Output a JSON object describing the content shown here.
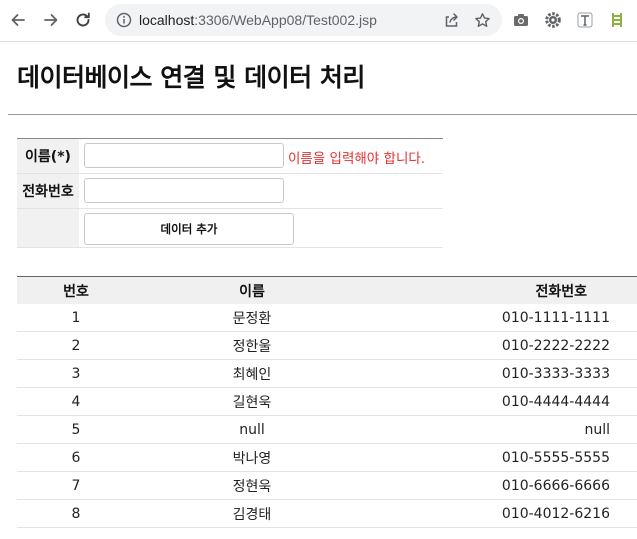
{
  "browser": {
    "url_host": "localhost",
    "url_rest": ":3306/WebApp08/Test002.jsp"
  },
  "page": {
    "title": "데이터베이스 연결 및 데이터 처리"
  },
  "form": {
    "name_label": "이름(*)",
    "name_value": "",
    "name_error": "이름을 입력해야 합니다.",
    "phone_label": "전화번호",
    "phone_value": "",
    "submit_label": "데이터 추가"
  },
  "table": {
    "headers": [
      "번호",
      "이름",
      "전화번호"
    ],
    "rows": [
      {
        "num": "1",
        "name": "문정환",
        "phone": "010-1111-1111"
      },
      {
        "num": "2",
        "name": "정한울",
        "phone": "010-2222-2222"
      },
      {
        "num": "3",
        "name": "최혜인",
        "phone": "010-3333-3333"
      },
      {
        "num": "4",
        "name": "길현욱",
        "phone": "010-4444-4444"
      },
      {
        "num": "5",
        "name": "null",
        "phone": "null"
      },
      {
        "num": "6",
        "name": "박나영",
        "phone": "010-5555-5555"
      },
      {
        "num": "7",
        "name": "정현욱",
        "phone": "010-6666-6666"
      },
      {
        "num": "8",
        "name": "김경태",
        "phone": "010-4012-6216"
      }
    ]
  },
  "colors": {
    "error": "#e53030",
    "header_bg": "#f0f0f0"
  }
}
